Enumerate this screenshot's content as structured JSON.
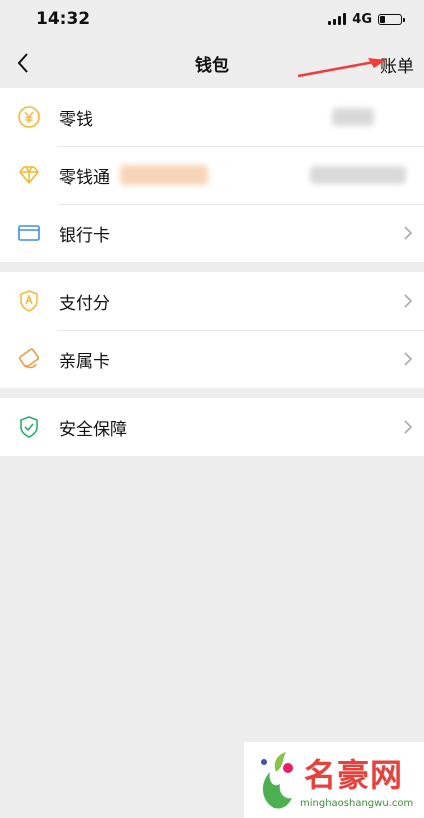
{
  "status_bar": {
    "time": "14:32",
    "network": "4G"
  },
  "nav": {
    "title": "钱包",
    "bill_label": "账单"
  },
  "groups": [
    {
      "items": [
        {
          "label": "零钱",
          "icon": "yuan-coin-icon",
          "icon_color": "#f5b82e"
        },
        {
          "label": "零钱通",
          "icon": "diamond-icon",
          "icon_color": "#f5b82e"
        },
        {
          "label": "银行卡",
          "icon": "bank-card-icon",
          "icon_color": "#3e8de6"
        }
      ]
    },
    {
      "items": [
        {
          "label": "支付分",
          "icon": "pay-score-icon",
          "icon_color": "#f5b82e"
        },
        {
          "label": "亲属卡",
          "icon": "family-card-icon",
          "icon_color": "#f09a3e"
        }
      ]
    },
    {
      "items": [
        {
          "label": "安全保障",
          "icon": "shield-check-icon",
          "icon_color": "#2aae67"
        }
      ]
    }
  ],
  "watermark": {
    "text": "名豪网",
    "url": "minghaoshangwu.com"
  },
  "colors": {
    "background": "#ededed",
    "annotation_arrow": "#f03c3c"
  }
}
